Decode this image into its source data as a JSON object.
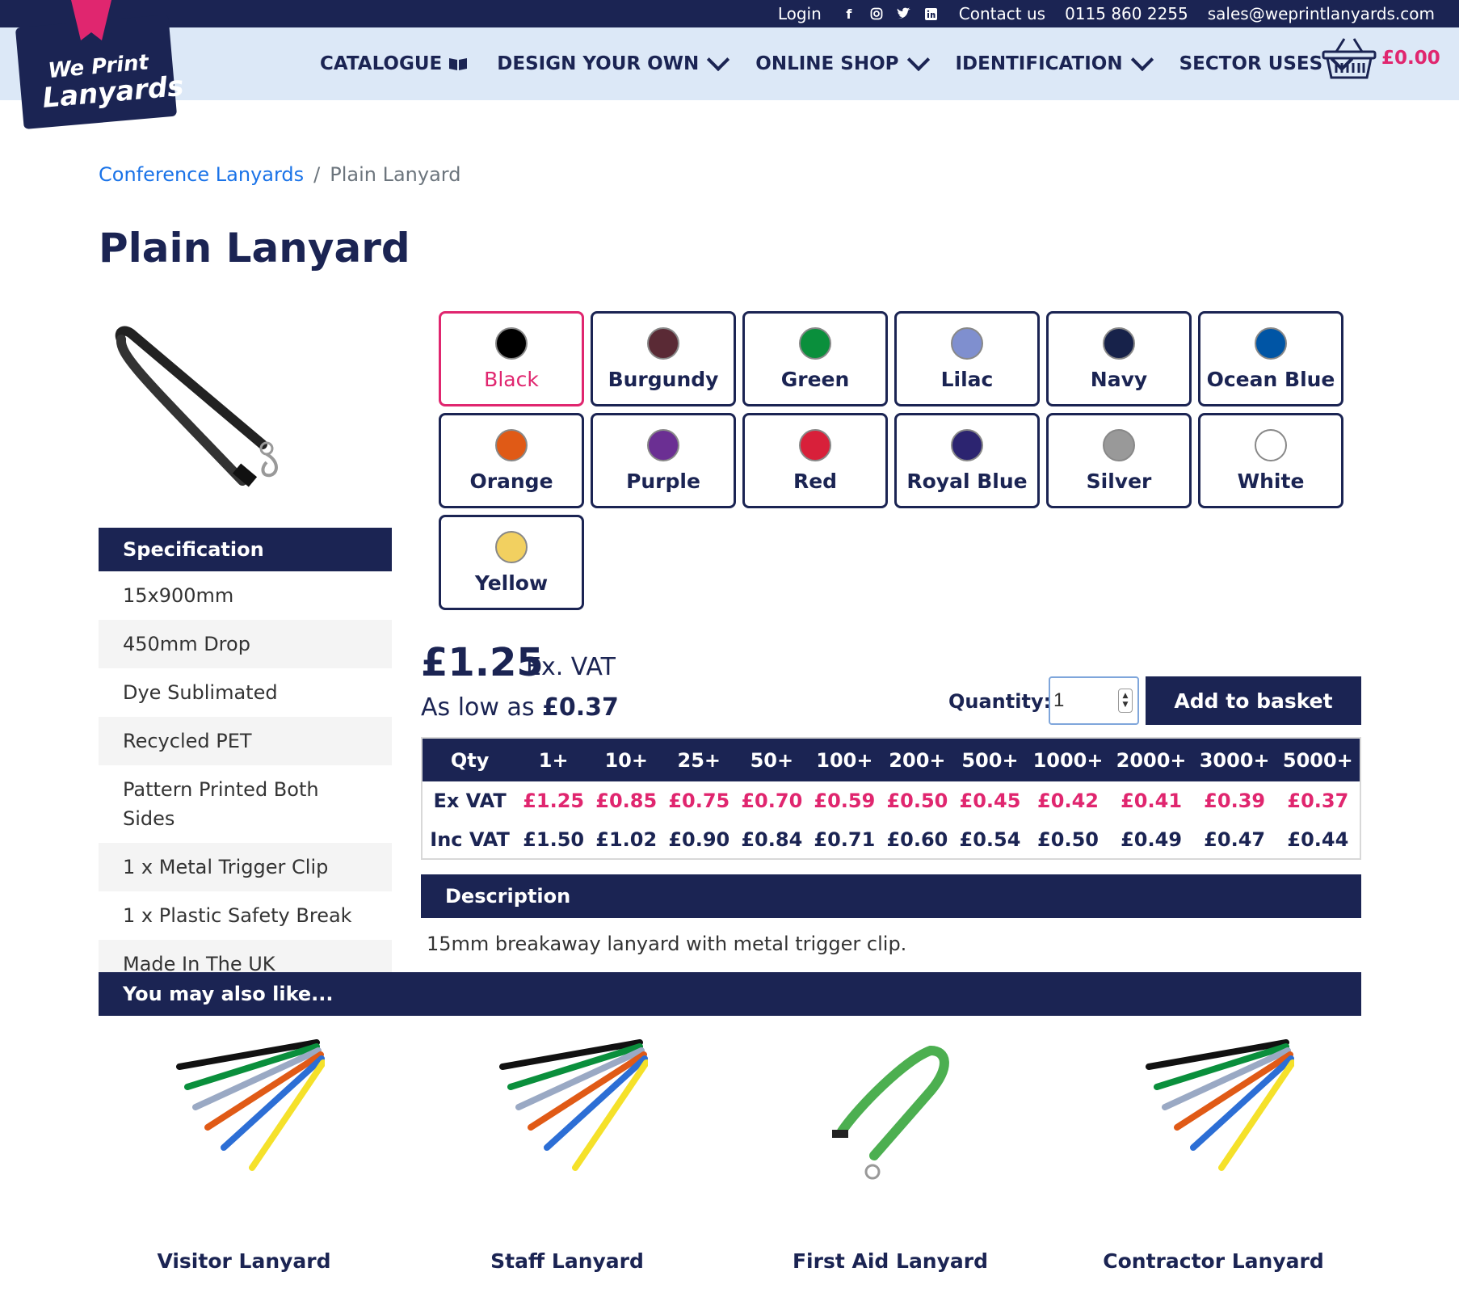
{
  "topbar": {
    "login": "Login",
    "contact": "Contact us",
    "phone": "0115 860 2255",
    "email": "sales@weprintlanyards.com"
  },
  "logo": {
    "line1": "We Print",
    "line2": "Lanyards"
  },
  "nav": {
    "items": [
      {
        "label": "CATALOGUE"
      },
      {
        "label": "DESIGN YOUR OWN"
      },
      {
        "label": "ONLINE SHOP"
      },
      {
        "label": "IDENTIFICATION"
      },
      {
        "label": "SECTOR USES"
      }
    ],
    "basket_total": "£0.00"
  },
  "breadcrumb": {
    "parent": "Conference Lanyards",
    "separator": "/",
    "current": "Plain Lanyard"
  },
  "product": {
    "title": "Plain Lanyard"
  },
  "specification": {
    "heading": "Specification",
    "items": [
      "15x900mm",
      "450mm Drop",
      "Dye Sublimated",
      "Recycled PET",
      "Pattern Printed Both Sides",
      "1 x Metal Trigger Clip",
      "1 x Plastic Safety Break",
      "Made In The UK"
    ]
  },
  "colours": {
    "selected": "Black",
    "options": [
      {
        "label": "Black",
        "hex": "#000000"
      },
      {
        "label": "Burgundy",
        "hex": "#5a2a35"
      },
      {
        "label": "Green",
        "hex": "#0a8f3c"
      },
      {
        "label": "Lilac",
        "hex": "#7f8fcf"
      },
      {
        "label": "Navy",
        "hex": "#17224a"
      },
      {
        "label": "Ocean Blue",
        "hex": "#0055a5"
      },
      {
        "label": "Orange",
        "hex": "#e05a16"
      },
      {
        "label": "Purple",
        "hex": "#6b2f93"
      },
      {
        "label": "Red",
        "hex": "#d8203a"
      },
      {
        "label": "Royal Blue",
        "hex": "#2c2470"
      },
      {
        "label": "Silver",
        "hex": "#999999"
      },
      {
        "label": "White",
        "hex": "#ffffff"
      },
      {
        "label": "Yellow",
        "hex": "#f2d060"
      }
    ]
  },
  "pricing": {
    "price": "£1.25",
    "price_suffix": "Ex. VAT",
    "as_low_prefix": "As low as",
    "as_low_value": "£0.37",
    "quantity_label": "Quantity:",
    "quantity_value": "1",
    "add_button": "Add to basket",
    "table": {
      "headers": [
        "Qty",
        "1+",
        "10+",
        "25+",
        "50+",
        "100+",
        "200+",
        "500+",
        "1000+",
        "2000+",
        "3000+",
        "5000+"
      ],
      "rows": [
        {
          "label": "Ex VAT",
          "values": [
            "£1.25",
            "£0.85",
            "£0.75",
            "£0.70",
            "£0.59",
            "£0.50",
            "£0.45",
            "£0.42",
            "£0.41",
            "£0.39",
            "£0.37"
          ]
        },
        {
          "label": "Inc VAT",
          "values": [
            "£1.50",
            "£1.02",
            "£0.90",
            "£0.84",
            "£0.71",
            "£0.60",
            "£0.54",
            "£0.50",
            "£0.49",
            "£0.47",
            "£0.44"
          ]
        }
      ]
    }
  },
  "description": {
    "heading": "Description",
    "text": "15mm breakaway lanyard with metal trigger clip."
  },
  "related": {
    "heading": "You may also like...",
    "items": [
      {
        "name": "Visitor Lanyard"
      },
      {
        "name": "Staff Lanyard"
      },
      {
        "name": "First Aid Lanyard"
      },
      {
        "name": "Contractor Lanyard"
      }
    ]
  },
  "accent": "#e0266f",
  "brand": "#1b2453"
}
